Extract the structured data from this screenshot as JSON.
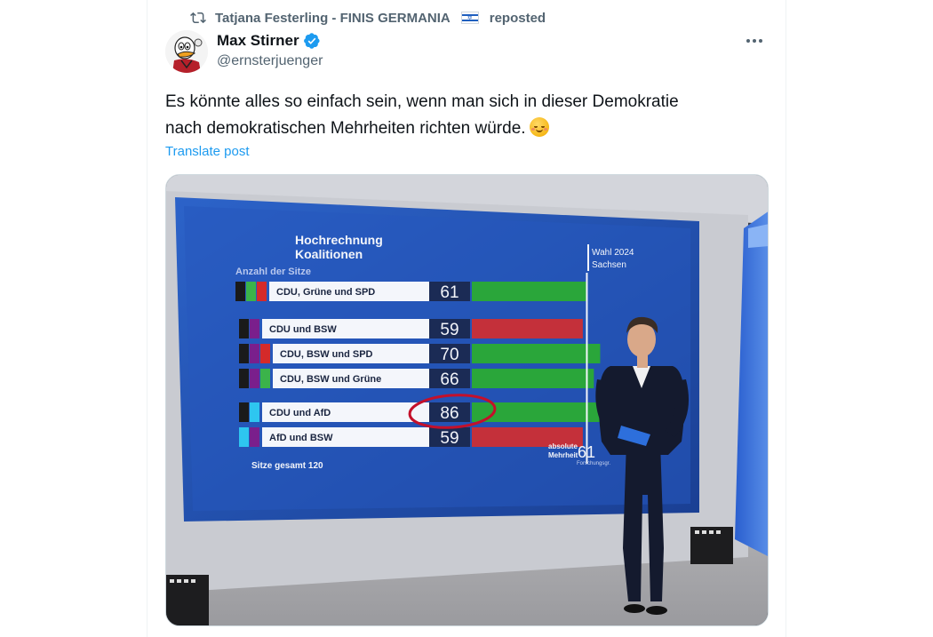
{
  "repost": {
    "text": "Tatjana Festerling - FINIS GERMANIA",
    "suffix": "reposted"
  },
  "author": {
    "name": "Max Stirner",
    "handle": "@ernsterjuenger"
  },
  "post": {
    "line1": "Es könnte alles so einfach sein, wenn man sich in dieser Demokratie",
    "line2": "nach demokratischen Mehrheiten richten würde.",
    "translate_label": "Translate post"
  },
  "media": {
    "title_line1": "Hochrechnung",
    "title_line2": "Koalitionen",
    "subtitle": "Anzahl der Sitze",
    "badge_line1": "Wahl 2024",
    "badge_line2": "Sachsen",
    "coalitions": [
      {
        "label": "CDU, Grüne und SPD",
        "seats": "61",
        "value": 61,
        "parties": [
          "#1a1a1a",
          "#3bb34a",
          "#d42a2a"
        ]
      },
      {
        "label": "CDU und BSW",
        "seats": "59",
        "value": 59,
        "parties": [
          "#1a1a1a",
          "#7a1f8c"
        ]
      },
      {
        "label": "CDU, BSW und SPD",
        "seats": "70",
        "value": 70,
        "parties": [
          "#1a1a1a",
          "#7a1f8c",
          "#d42a2a"
        ]
      },
      {
        "label": "CDU, BSW und Grüne",
        "seats": "66",
        "value": 66,
        "parties": [
          "#1a1a1a",
          "#7a1f8c",
          "#3bb34a"
        ]
      },
      {
        "label": "CDU und AfD",
        "seats": "86",
        "value": 86,
        "parties": [
          "#1a1a1a",
          "#2ec6f0"
        ]
      },
      {
        "label": "AfD und BSW",
        "seats": "59",
        "value": 59,
        "parties": [
          "#2ec6f0",
          "#7a1f8c"
        ]
      }
    ],
    "majority_label_line1": "absolute",
    "majority_label_line2": "Mehrheit",
    "majority_value": "61",
    "majority_source": "Forschungsgr.",
    "total_label": "Sitze gesamt 120",
    "colors": {
      "majority_bar": "#2aa63a",
      "minority_bar": "#c4303a",
      "screen": "#1f4fb0"
    }
  }
}
